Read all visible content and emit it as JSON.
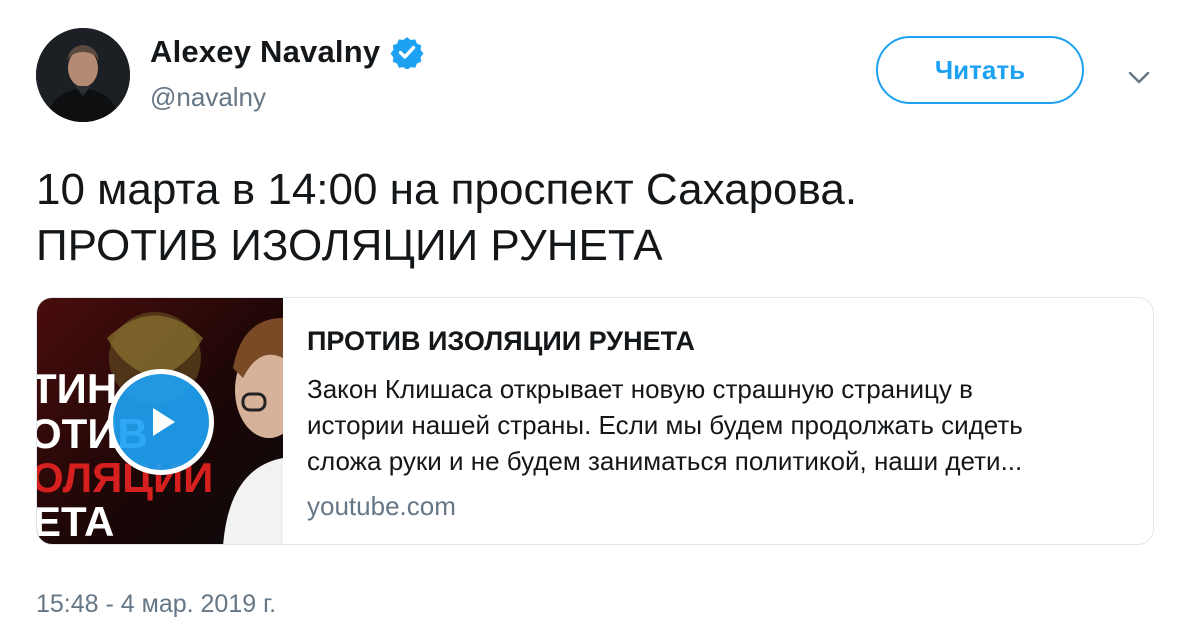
{
  "author": {
    "display_name": "Alexey Navalny",
    "handle": "@navalny",
    "verified": true
  },
  "follow_button": {
    "label": "Читать"
  },
  "tweet": {
    "text_line1": "10 марта в 14:00 на проспект Сахарова.",
    "text_line2": "ПРОТИВ ИЗОЛЯЦИИ РУНЕТА",
    "timestamp": "15:48 - 4 мар. 2019 г."
  },
  "card": {
    "title": "ПРОТИВ ИЗОЛЯЦИИ РУНЕТА",
    "desc_line1": "Закон Клишаса открывает новую страшную страницу в",
    "desc_line2": "истории нашей страны. Если мы будем продолжать сидеть",
    "desc_line3": "сложа руки и не будем заниматься политикой, наши дети...",
    "domain": "youtube.com",
    "thumbnail": {
      "text_lines": [
        "ТИН",
        "ОТИВ",
        "ОЛЯЦИИ",
        "ЕТА"
      ]
    }
  },
  "colors": {
    "accent": "#1da1f2",
    "secondary_text": "#657786",
    "border": "#e1e8ed"
  },
  "icons": [
    "verified-badge-icon",
    "chevron-down-icon",
    "play-icon"
  ]
}
